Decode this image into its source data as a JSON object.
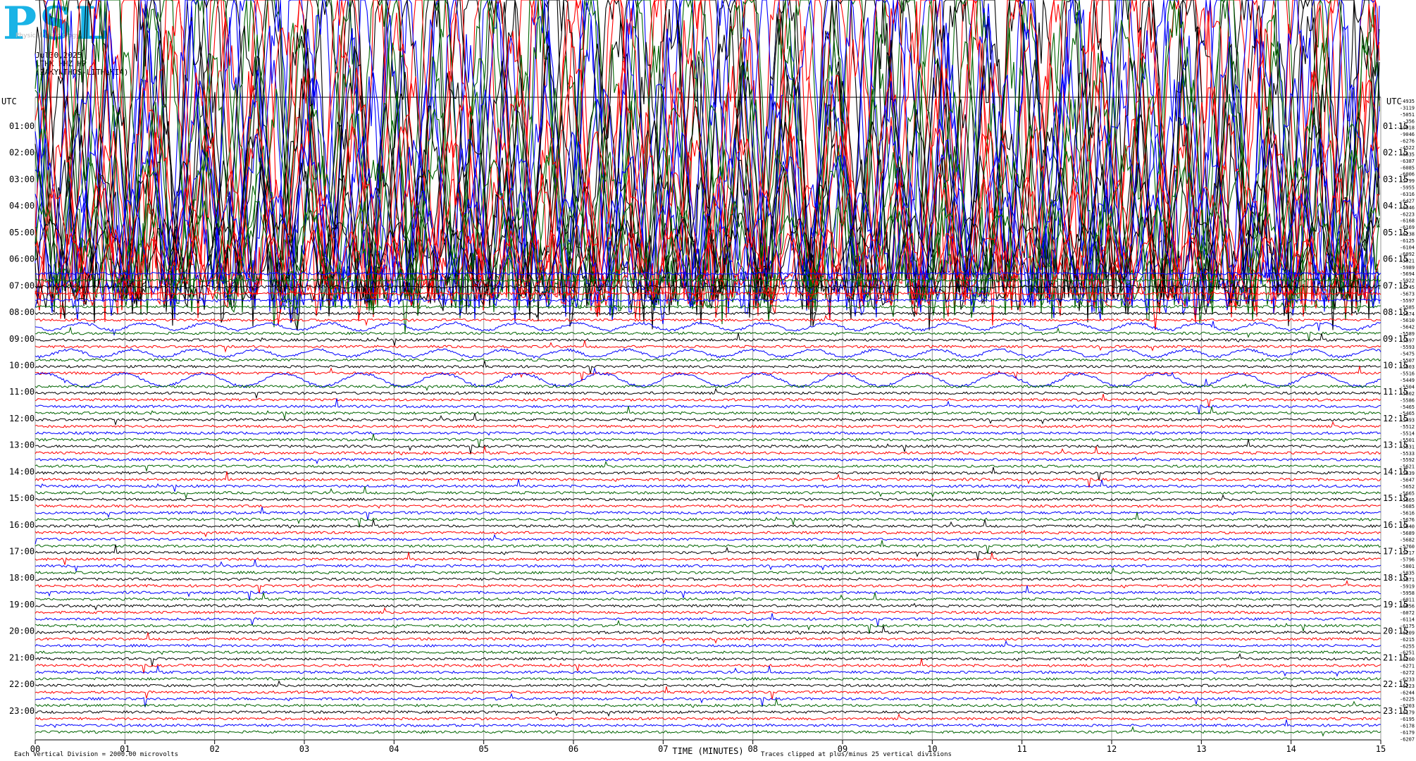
{
  "header": {
    "logo_text": "PSL",
    "logo_sub": "Physical Seismology",
    "date": "Jul30,2025",
    "station": "LTHK HHZ HP",
    "location": "(ZAKYNTHOS-LITHAKIA)"
  },
  "chart_data": {
    "type": "line",
    "title": "",
    "left_axis_label": "UTC",
    "right_axis_label": "UTC",
    "xlabel": "TIME (MINUTES)",
    "x_ticks": [
      "00",
      "01",
      "02",
      "03",
      "04",
      "05",
      "06",
      "07",
      "08",
      "09",
      "10",
      "11",
      "12",
      "13",
      "14",
      "15"
    ],
    "xlim": [
      0,
      15
    ],
    "left_hour_labels": [
      "01:00",
      "02:00",
      "03:00",
      "04:00",
      "05:00",
      "06:00",
      "07:00",
      "08:00",
      "09:00",
      "10:00",
      "11:00",
      "12:00",
      "13:00",
      "14:00",
      "15:00",
      "16:00",
      "17:00",
      "18:00",
      "19:00",
      "20:00",
      "21:00",
      "22:00",
      "23:00"
    ],
    "right_hour_labels": [
      "01:15",
      "02:15",
      "03:15",
      "04:15",
      "05:15",
      "06:15",
      "07:15",
      "08:15",
      "09:15",
      "10:15",
      "11:15",
      "12:15",
      "13:15",
      "14:15",
      "15:15",
      "16:15",
      "17:15",
      "18:15",
      "19:15",
      "20:15",
      "21:15",
      "22:15",
      "23:15"
    ],
    "trace_offsets": [
      "-4935",
      "-3119",
      "-5051",
      "-356",
      "-10918",
      "-9046",
      "-6276",
      "-4522",
      "-6635",
      "-6387",
      "-6085",
      "-6006",
      "-5799",
      "-5955",
      "-6316",
      "-6427",
      "-6346",
      "-6223",
      "-6168",
      "-6169",
      "-6238",
      "-6125",
      "-6104",
      "-6092",
      "-5921",
      "-5989",
      "-5694",
      "-5922",
      "-5745",
      "-5673",
      "-5597",
      "-5585",
      "-5674",
      "-5610",
      "-5642",
      "-5589",
      "-5597",
      "-5593",
      "-5475",
      "-5507",
      "-5503",
      "-5516",
      "-5449",
      "-5504",
      "-5502",
      "-5586",
      "-5465",
      "-5465",
      "-5493",
      "-5512",
      "-5514",
      "-5501",
      "-5531",
      "-5533",
      "-5592",
      "-5621",
      "-5639",
      "-5647",
      "-5652",
      "-5665",
      "-5665",
      "-5685",
      "-5616",
      "-5676",
      "-5640",
      "-5689",
      "-5682",
      "-5760",
      "-5717",
      "-5796",
      "-5801",
      "-5835",
      "-5871",
      "-5919",
      "-5958",
      "-6011",
      "-6056",
      "-6072",
      "-6114",
      "-6175",
      "-6209",
      "-6215",
      "-6255",
      "-6251",
      "-6260",
      "-6271",
      "-6272",
      "-6233",
      "-6223",
      "-6244",
      "-6225",
      "-6203",
      "-6179",
      "-6195",
      "-6178",
      "-6179",
      "-6207"
    ],
    "trace_colors": [
      "#000000",
      "#ff0000",
      "#0000ff",
      "#006400"
    ],
    "trace_count": 96,
    "clipping_rows": 26,
    "footer_left": "Each Vertical Division = 2000.00 microvolts",
    "footer_right": "Traces clipped at plus/minus 25 vertical divisions",
    "grid": true
  }
}
